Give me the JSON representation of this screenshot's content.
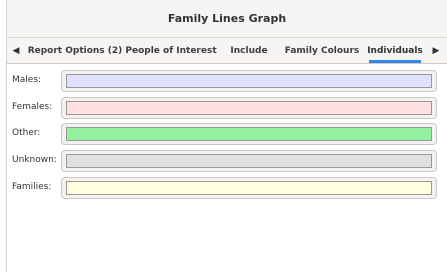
{
  "window": {
    "title": "Family Lines Graph"
  },
  "tabs": {
    "items": [
      {
        "label": "Report Options (2)"
      },
      {
        "label": "People of Interest"
      },
      {
        "label": "Include"
      },
      {
        "label": "Family Colours"
      },
      {
        "label": "Individuals"
      }
    ],
    "active": "Individuals",
    "scroll_left_icon": "triangle-left-icon",
    "scroll_right_icon": "triangle-right-icon",
    "accent_color": "#3584e4"
  },
  "individuals": {
    "rows": [
      {
        "label": "Males:",
        "color": "#e0e0ff"
      },
      {
        "label": "Females:",
        "color": "#ffe0e0"
      },
      {
        "label": "Other:",
        "color": "#94ef9e"
      },
      {
        "label": "Unknown:",
        "color": "#e0e0e0"
      },
      {
        "label": "Families:",
        "color": "#ffffe0"
      }
    ]
  }
}
